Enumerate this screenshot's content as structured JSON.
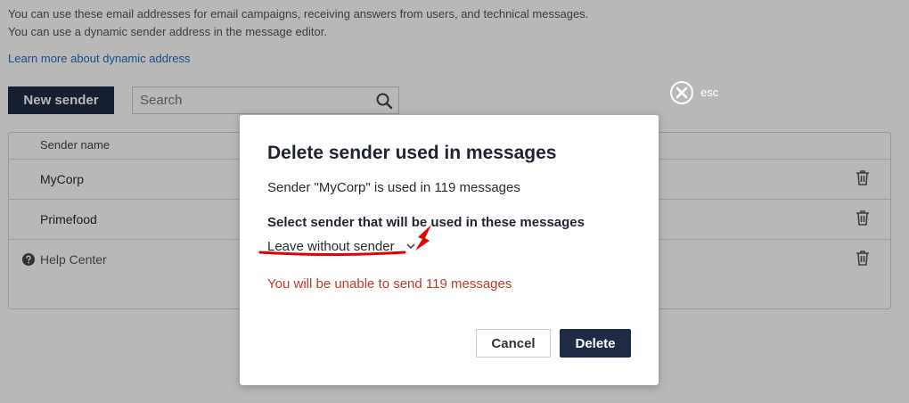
{
  "page": {
    "description_line1": "You can use these email addresses for email campaigns, receiving answers from users, and technical messages.",
    "description_line2": "You can use a dynamic sender address in the message editor.",
    "learn_more_link": "Learn more about dynamic address",
    "new_sender_button": "New sender",
    "search_placeholder": "Search",
    "search_value": "",
    "table": {
      "header": "Sender name",
      "rows": [
        {
          "name": "MyCorp"
        },
        {
          "name": "Primefood"
        }
      ],
      "help_center": "Help Center"
    },
    "icons": {
      "search": "search-icon",
      "trash": "trash-icon",
      "help": "question-circle-icon"
    }
  },
  "overlay": {
    "esc_label": "esc",
    "close_icon": "close-circle-icon"
  },
  "modal": {
    "title": "Delete sender used in messages",
    "info": "Sender \"MyCorp\" is used in 119 messages",
    "select_label": "Select sender that will be used in these messages",
    "dropdown_value": "Leave without sender",
    "warning": "You will be unable to send 119 messages",
    "cancel_button": "Cancel",
    "delete_button": "Delete"
  },
  "colors": {
    "primary_dark": "#1f2a44",
    "link": "#2a6db5",
    "warning": "#c0392b",
    "annotation_red": "#e00000"
  }
}
